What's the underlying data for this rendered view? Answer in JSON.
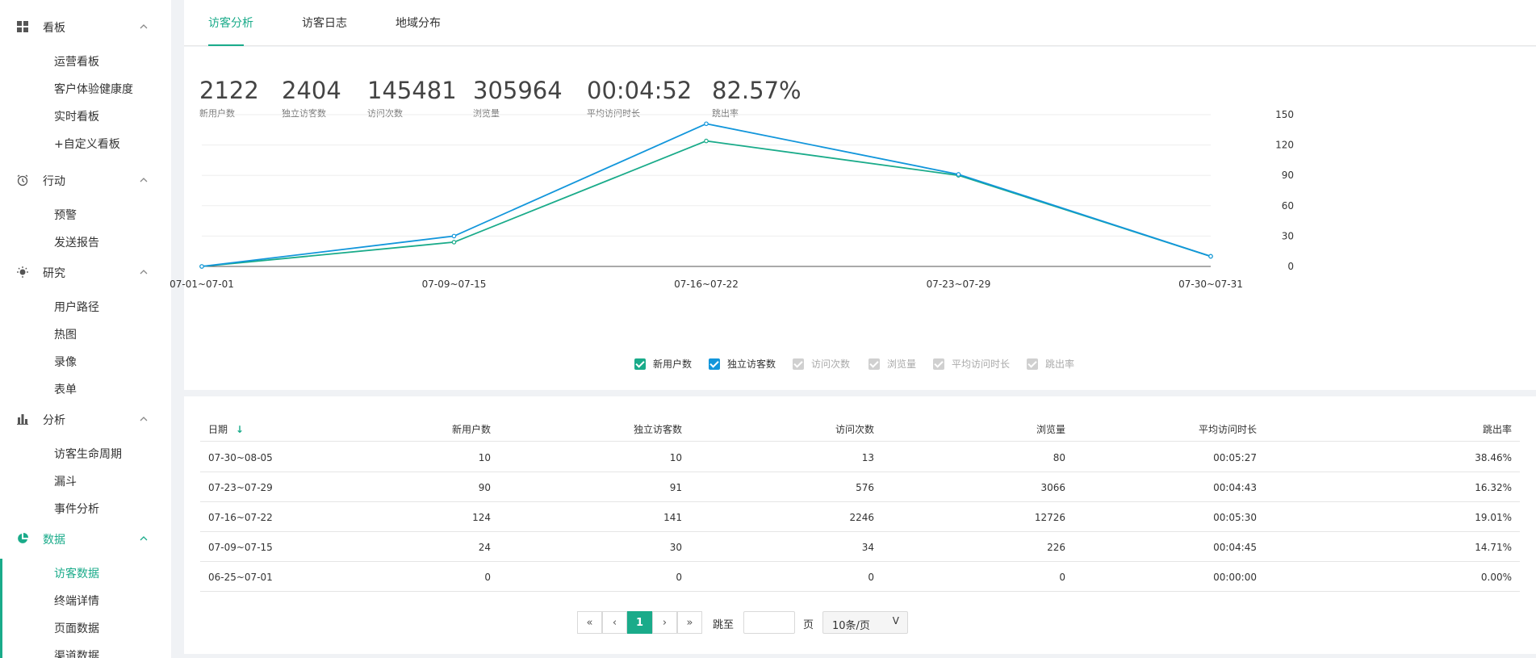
{
  "sidebar": {
    "groups": [
      {
        "label": "看板",
        "icon": "dashboard-grid-icon",
        "items": [
          "运营看板",
          "客户体验健康度",
          "实时看板",
          "+自定义看板"
        ]
      },
      {
        "label": "行动",
        "icon": "alarm-clock-icon",
        "items": [
          "预警",
          "发送报告"
        ]
      },
      {
        "label": "研究",
        "icon": "lightbulb-icon",
        "items": [
          "用户路径",
          "热图",
          "录像",
          "表单"
        ]
      },
      {
        "label": "分析",
        "icon": "bar-chart-icon",
        "items": [
          "访客生命周期",
          "漏斗",
          "事件分析"
        ]
      },
      {
        "label": "数据",
        "icon": "pie-chart-icon",
        "items": [
          "访客数据",
          "终端详情",
          "页面数据",
          "渠道数据"
        ]
      }
    ],
    "active_group": "数据",
    "active_item": "访客数据"
  },
  "tabs": [
    "访客分析",
    "访客日志",
    "地域分布"
  ],
  "active_tab": "访客分析",
  "kpis": [
    {
      "value": "2122",
      "label": "新用户数"
    },
    {
      "value": "2404",
      "label": "独立访客数"
    },
    {
      "value": "145481",
      "label": "访问次数"
    },
    {
      "value": "305964",
      "label": "浏览量"
    },
    {
      "value": "00:04:52",
      "label": "平均访问时长"
    },
    {
      "value": "82.57%",
      "label": "跳出率"
    }
  ],
  "legend": [
    {
      "label": "新用户数",
      "checked": true,
      "color": "#1aab8a"
    },
    {
      "label": "独立访客数",
      "checked": true,
      "color": "#1296db"
    },
    {
      "label": "访问次数",
      "checked": false
    },
    {
      "label": "浏览量",
      "checked": false
    },
    {
      "label": "平均访问时长",
      "checked": false
    },
    {
      "label": "跳出率",
      "checked": false
    }
  ],
  "colors": {
    "accent": "#1aab8a",
    "line_new_users": "#1aab8a",
    "line_unique_visitors": "#1296db"
  },
  "chart_data": {
    "type": "line",
    "categories": [
      "07-01~07-01",
      "07-09~07-15",
      "07-16~07-22",
      "07-23~07-29",
      "07-30~07-31"
    ],
    "series": [
      {
        "name": "新用户数",
        "values": [
          0,
          24,
          124,
          90,
          10
        ],
        "color": "#1aab8a"
      },
      {
        "name": "独立访客数",
        "values": [
          0,
          30,
          141,
          91,
          10
        ],
        "color": "#1296db"
      }
    ],
    "y_ticks": [
      "0",
      "30",
      "60",
      "90",
      "120",
      "150"
    ],
    "ylim": [
      0,
      150
    ],
    "y_axis_side": "right",
    "grid": true
  },
  "table": {
    "columns": [
      "日期",
      "新用户数",
      "独立访客数",
      "访问次数",
      "浏览量",
      "平均访问时长",
      "跳出率"
    ],
    "sort_indicator": "↓",
    "rows": [
      [
        "07-30~08-05",
        "10",
        "10",
        "13",
        "80",
        "00:05:27",
        "38.46%"
      ],
      [
        "07-23~07-29",
        "90",
        "91",
        "576",
        "3066",
        "00:04:43",
        "16.32%"
      ],
      [
        "07-16~07-22",
        "124",
        "141",
        "2246",
        "12726",
        "00:05:30",
        "19.01%"
      ],
      [
        "07-09~07-15",
        "24",
        "30",
        "34",
        "226",
        "00:04:45",
        "14.71%"
      ],
      [
        "06-25~07-01",
        "0",
        "0",
        "0",
        "0",
        "00:00:00",
        "0.00%"
      ]
    ]
  },
  "pagination": {
    "first": "«",
    "prev": "‹",
    "current": "1",
    "next": "›",
    "last": "»",
    "jump_label": "跳至",
    "jump_value": "",
    "page_unit": "页",
    "page_size": "10条/页",
    "page_size_caret": "V"
  }
}
